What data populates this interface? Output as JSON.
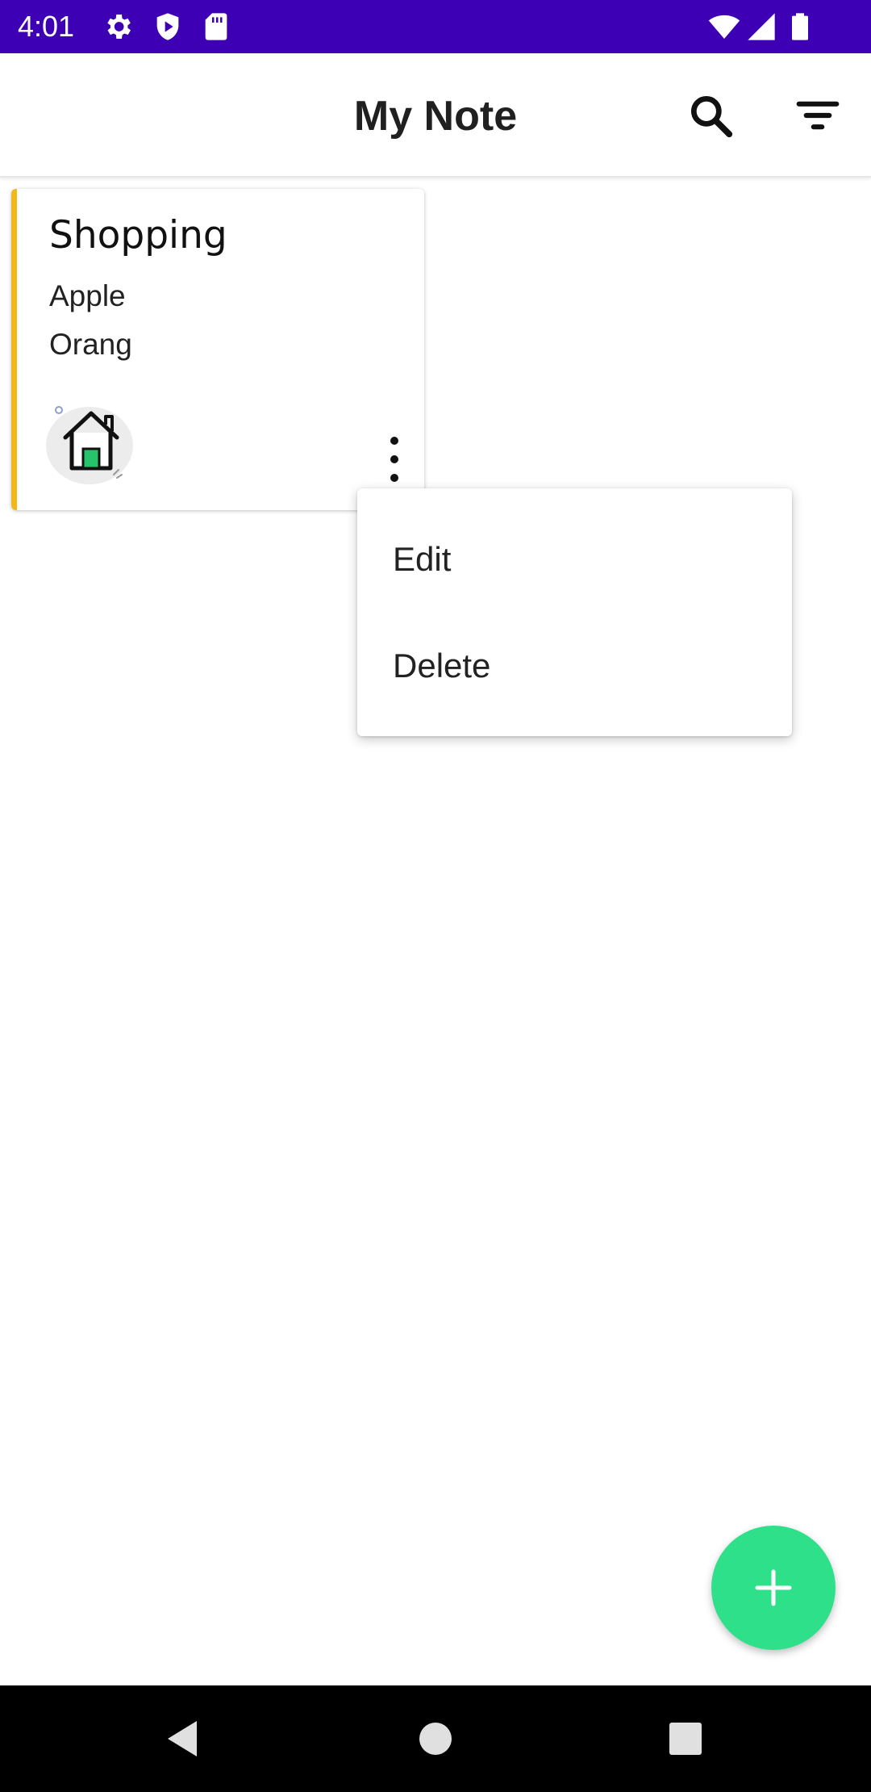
{
  "status_bar": {
    "time": "4:01",
    "icons": [
      "settings-icon",
      "shield-icon",
      "sd-card-icon",
      "wifi-icon",
      "cell-signal-icon",
      "battery-icon"
    ],
    "background": "#3d00b5"
  },
  "app_bar": {
    "title": "My Note",
    "actions": [
      "search-icon",
      "filter-icon"
    ]
  },
  "notes": [
    {
      "title": "Shopping",
      "lines": [
        "Apple",
        "Orang"
      ],
      "accent_color": "#f2b81a",
      "icon": "home-icon"
    }
  ],
  "popup_menu": {
    "items": [
      "Edit",
      "Delete"
    ]
  },
  "fab": {
    "icon": "plus-icon",
    "color": "#2fe08a"
  },
  "nav_bar": {
    "buttons": [
      "back-icon",
      "home-circle-icon",
      "recents-icon"
    ]
  }
}
